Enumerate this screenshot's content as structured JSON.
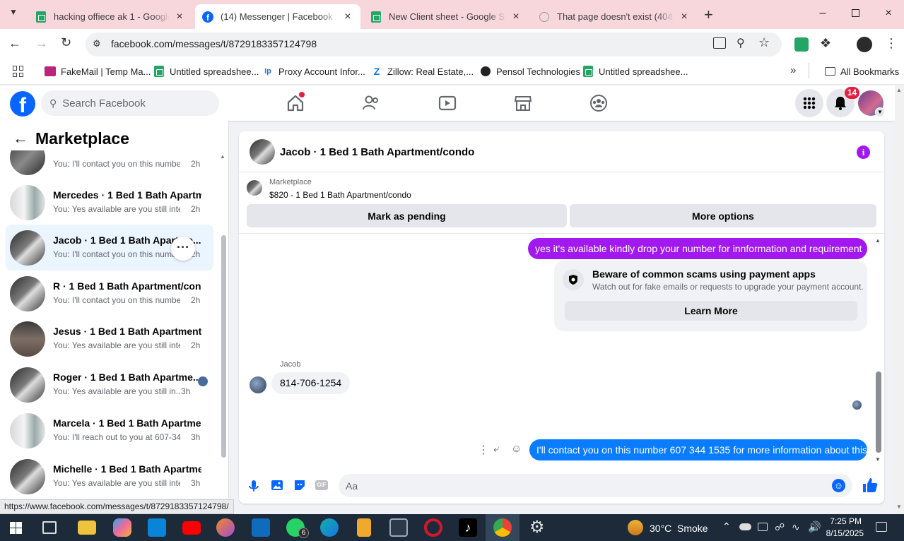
{
  "browser": {
    "tabs": [
      {
        "label": "hacking offiece ak 1 - Google Sheets",
        "icon": "sheets-icon"
      },
      {
        "label": "(14) Messenger | Facebook",
        "icon": "facebook-icon"
      },
      {
        "label": "New Client sheet - Google Sheets",
        "icon": "sheets-icon"
      },
      {
        "label": "That page doesn't exist (404) - Facebook",
        "icon": "error-icon"
      }
    ],
    "url": "facebook.com/messages/t/8729183357124798",
    "bookmarks": [
      {
        "label": "FakeMail | Temp Ma..."
      },
      {
        "label": "Untitled spreadshee..."
      },
      {
        "label": "Proxy Account Infor..."
      },
      {
        "label": "Zillow: Real Estate,..."
      },
      {
        "label": "Pensol Technologies"
      },
      {
        "label": "Untitled spreadshee..."
      }
    ],
    "all_bookmarks": "All Bookmarks",
    "status_url": "https://www.facebook.com/messages/t/8729183357124798/"
  },
  "facebook": {
    "logo": "f",
    "search_placeholder": "Search Facebook",
    "notification_count": "14",
    "accent": "#0866ff"
  },
  "sidebar": {
    "title": "Marketplace",
    "conversations": [
      {
        "name": "",
        "preview": "You: I'll contact you on this number...",
        "time": "2h"
      },
      {
        "name": "Mercedes · 1 Bed 1 Bath Apartm...",
        "preview": "You: Yes available are you still inter...",
        "time": "2h"
      },
      {
        "name": "Jacob · 1 Bed 1 Bath Apartme...",
        "preview": "You: I'll contact you on this numb...",
        "time": "2h"
      },
      {
        "name": "R · 1 Bed 1 Bath Apartment/condo",
        "preview": "You: I'll contact you on this number...",
        "time": "2h"
      },
      {
        "name": "Jesus · 1 Bed 1 Bath Apartment/...",
        "preview": "You: Yes available are you still inter...",
        "time": "2h"
      },
      {
        "name": "Roger · 1 Bed 1 Bath Apartme...",
        "preview": "You: Yes available are you still in...",
        "time": "3h"
      },
      {
        "name": "Marcela · 1 Bed 1 Bath Apartme...",
        "preview": "You: I'll reach out to you at 607-34...",
        "time": "3h"
      },
      {
        "name": "Michelle · 1 Bed 1 Bath Apartme...",
        "preview": "You: Yes available are you still inter...",
        "time": "3h"
      }
    ]
  },
  "chat": {
    "title": "Jacob · 1 Bed 1 Bath Apartment/condo",
    "listing_source": "Marketplace",
    "listing": "$820 - 1 Bed 1 Bath Apartment/condo",
    "mark_pending": "Mark as pending",
    "more_options": "More options",
    "msg_out_1": "yes it's available kindly drop your  number for  innformation and requirement",
    "warning_title": "Beware of common scams using payment apps",
    "warning_body": "Watch out for fake emails or requests to upgrade your payment account.",
    "learn_more": "Learn More",
    "sender": "Jacob",
    "msg_in_1": "814-706-1254",
    "msg_out_2": "I'll contact you on this number 607 344 1535 for more information about this",
    "composer_placeholder": "Aa",
    "purple": "#a219ef",
    "blue": "#0a7cff"
  },
  "taskbar": {
    "weather_temp": "30°C",
    "weather_desc": "Smoke",
    "whatsapp_badge": "6",
    "time": "7:25 PM",
    "date": "8/15/2025"
  }
}
